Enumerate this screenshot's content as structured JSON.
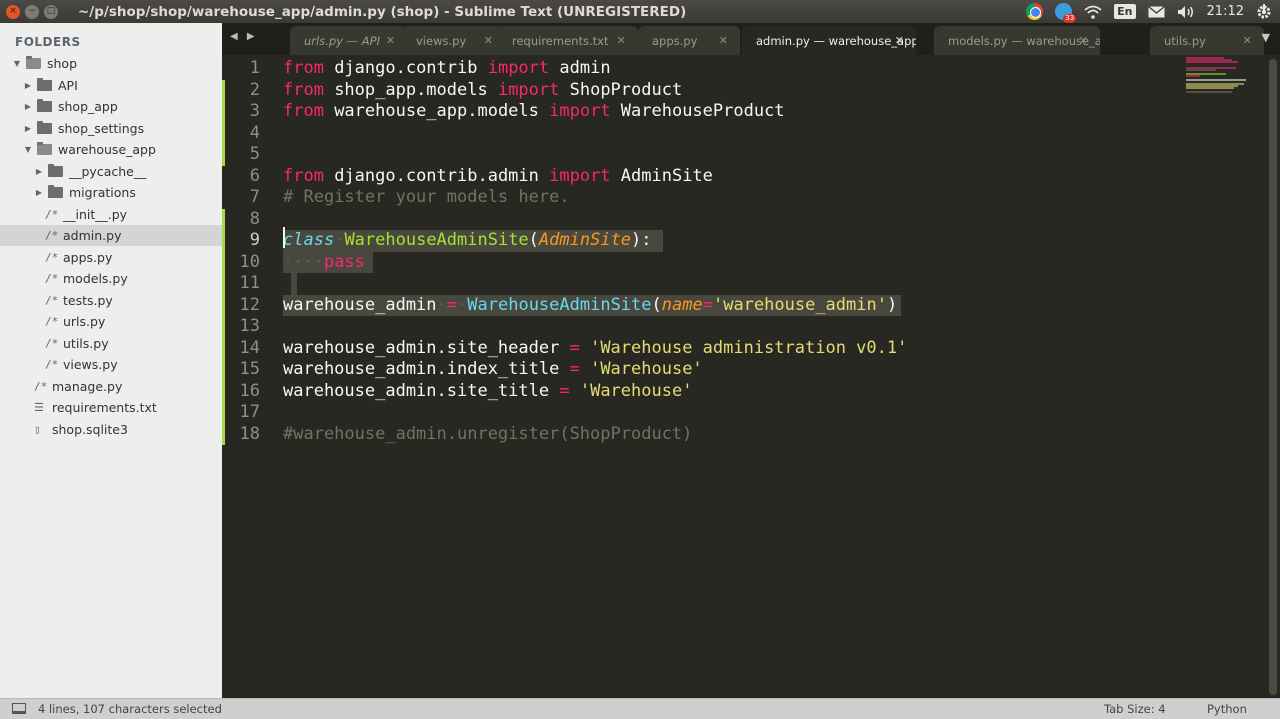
{
  "window": {
    "title": "~/p/shop/shop/warehouse_app/admin.py (shop) - Sublime Text (UNREGISTERED)",
    "close_glyph": "×",
    "min_glyph": "−",
    "max_glyph": "□"
  },
  "tray": {
    "telegram_badge": "33",
    "keyboard_layout": "En",
    "clock": "21:12",
    "icons": [
      "chrome-icon",
      "telegram-icon",
      "wifi-icon",
      "keyboard-layout-icon",
      "mail-icon",
      "volume-icon",
      "settings-gear-icon"
    ]
  },
  "sidebar": {
    "header": "FOLDERS",
    "items": [
      {
        "label": "shop",
        "type": "folder",
        "expanded": true
      },
      {
        "label": "API",
        "type": "folder",
        "expanded": false
      },
      {
        "label": "shop_app",
        "type": "folder",
        "expanded": false
      },
      {
        "label": "shop_settings",
        "type": "folder",
        "expanded": false
      },
      {
        "label": "warehouse_app",
        "type": "folder",
        "expanded": true
      },
      {
        "label": "__pycache__",
        "type": "folder",
        "expanded": false
      },
      {
        "label": "migrations",
        "type": "folder",
        "expanded": false
      },
      {
        "label": "__init__.py",
        "type": "file"
      },
      {
        "label": "admin.py",
        "type": "file",
        "selected": true
      },
      {
        "label": "apps.py",
        "type": "file"
      },
      {
        "label": "models.py",
        "type": "file"
      },
      {
        "label": "tests.py",
        "type": "file"
      },
      {
        "label": "urls.py",
        "type": "file"
      },
      {
        "label": "utils.py",
        "type": "file"
      },
      {
        "label": "views.py",
        "type": "file"
      },
      {
        "label": "manage.py",
        "type": "file"
      },
      {
        "label": "requirements.txt",
        "type": "text"
      },
      {
        "label": "shop.sqlite3",
        "type": "blank"
      }
    ]
  },
  "tabs": {
    "nav": "◀ ▶",
    "close_glyph": "✕",
    "dropdown": "▼",
    "items": [
      {
        "label": "urls.py — API",
        "active": false
      },
      {
        "label": "views.py",
        "active": false
      },
      {
        "label": "requirements.txt",
        "active": false
      },
      {
        "label": "apps.py",
        "active": false
      },
      {
        "label": "admin.py — warehouse_app",
        "active": true
      },
      {
        "label": "models.py — warehouse_app",
        "active": false
      },
      {
        "label": "utils.py",
        "active": false
      }
    ]
  },
  "editor": {
    "line_numbers": [
      "1",
      "2",
      "3",
      "4",
      "5",
      "6",
      "7",
      "8",
      "9",
      "10",
      "11",
      "12",
      "13",
      "14",
      "15",
      "16",
      "17",
      "18"
    ],
    "current_line": 9,
    "lines": [
      [
        [
          "kw",
          "from"
        ],
        [
          "",
          "·django.contrib·"
        ],
        [
          "kw",
          "import"
        ],
        [
          "",
          "·admin"
        ]
      ],
      [
        [
          "kw",
          "from"
        ],
        [
          "",
          "·shop_app.models·"
        ],
        [
          "kw",
          "import"
        ],
        [
          "",
          "·ShopProduct"
        ]
      ],
      [
        [
          "kw",
          "from"
        ],
        [
          "",
          "·warehouse_app.models·"
        ],
        [
          "kw",
          "import"
        ],
        [
          "",
          "·WarehouseProduct"
        ]
      ],
      [],
      [],
      [
        [
          "kw",
          "from"
        ],
        [
          "",
          "·django.contrib.admin·"
        ],
        [
          "kw",
          "import"
        ],
        [
          "",
          "·AdminSite"
        ]
      ],
      [
        [
          "cmt",
          "# Register your models here."
        ]
      ],
      [],
      [
        [
          "cls",
          "class"
        ],
        [
          "ws",
          "·"
        ],
        [
          "fn",
          "WarehouseAdminSite"
        ],
        [
          "",
          "("
        ],
        [
          "fn param",
          "AdminSite"
        ],
        [
          "",
          "):"
        ]
      ],
      [
        [
          "ws",
          "····"
        ],
        [
          "kw",
          "pass"
        ]
      ],
      [],
      [
        [
          "",
          "warehouse_admin"
        ],
        [
          "ws",
          "·"
        ],
        [
          "kw",
          "="
        ],
        [
          "ws",
          "·"
        ],
        [
          "cls2",
          "WarehouseAdminSite"
        ],
        [
          "",
          "("
        ],
        [
          "param",
          "name"
        ],
        [
          "kw",
          "="
        ],
        [
          "str",
          "'warehouse_admin'"
        ],
        [
          "",
          ")"
        ]
      ],
      [],
      [
        [
          "",
          "warehouse_admin.site_header·"
        ],
        [
          "kw",
          "="
        ],
        [
          "",
          "·"
        ],
        [
          "str",
          "'Warehouse administration v0.1'"
        ]
      ],
      [
        [
          "",
          "warehouse_admin.index_title·"
        ],
        [
          "kw",
          "="
        ],
        [
          "",
          "·"
        ],
        [
          "str",
          "'Warehouse'"
        ]
      ],
      [
        [
          "",
          "warehouse_admin.site_title·"
        ],
        [
          "kw",
          "="
        ],
        [
          "",
          "·"
        ],
        [
          "str",
          "'Warehouse'"
        ]
      ],
      [],
      [
        [
          "cmt",
          "#warehouse_admin.unregister(ShopProduct)"
        ]
      ]
    ]
  },
  "status": {
    "selection": "4 lines, 107 characters selected",
    "tab_size": "Tab Size: 4",
    "syntax": "Python"
  }
}
